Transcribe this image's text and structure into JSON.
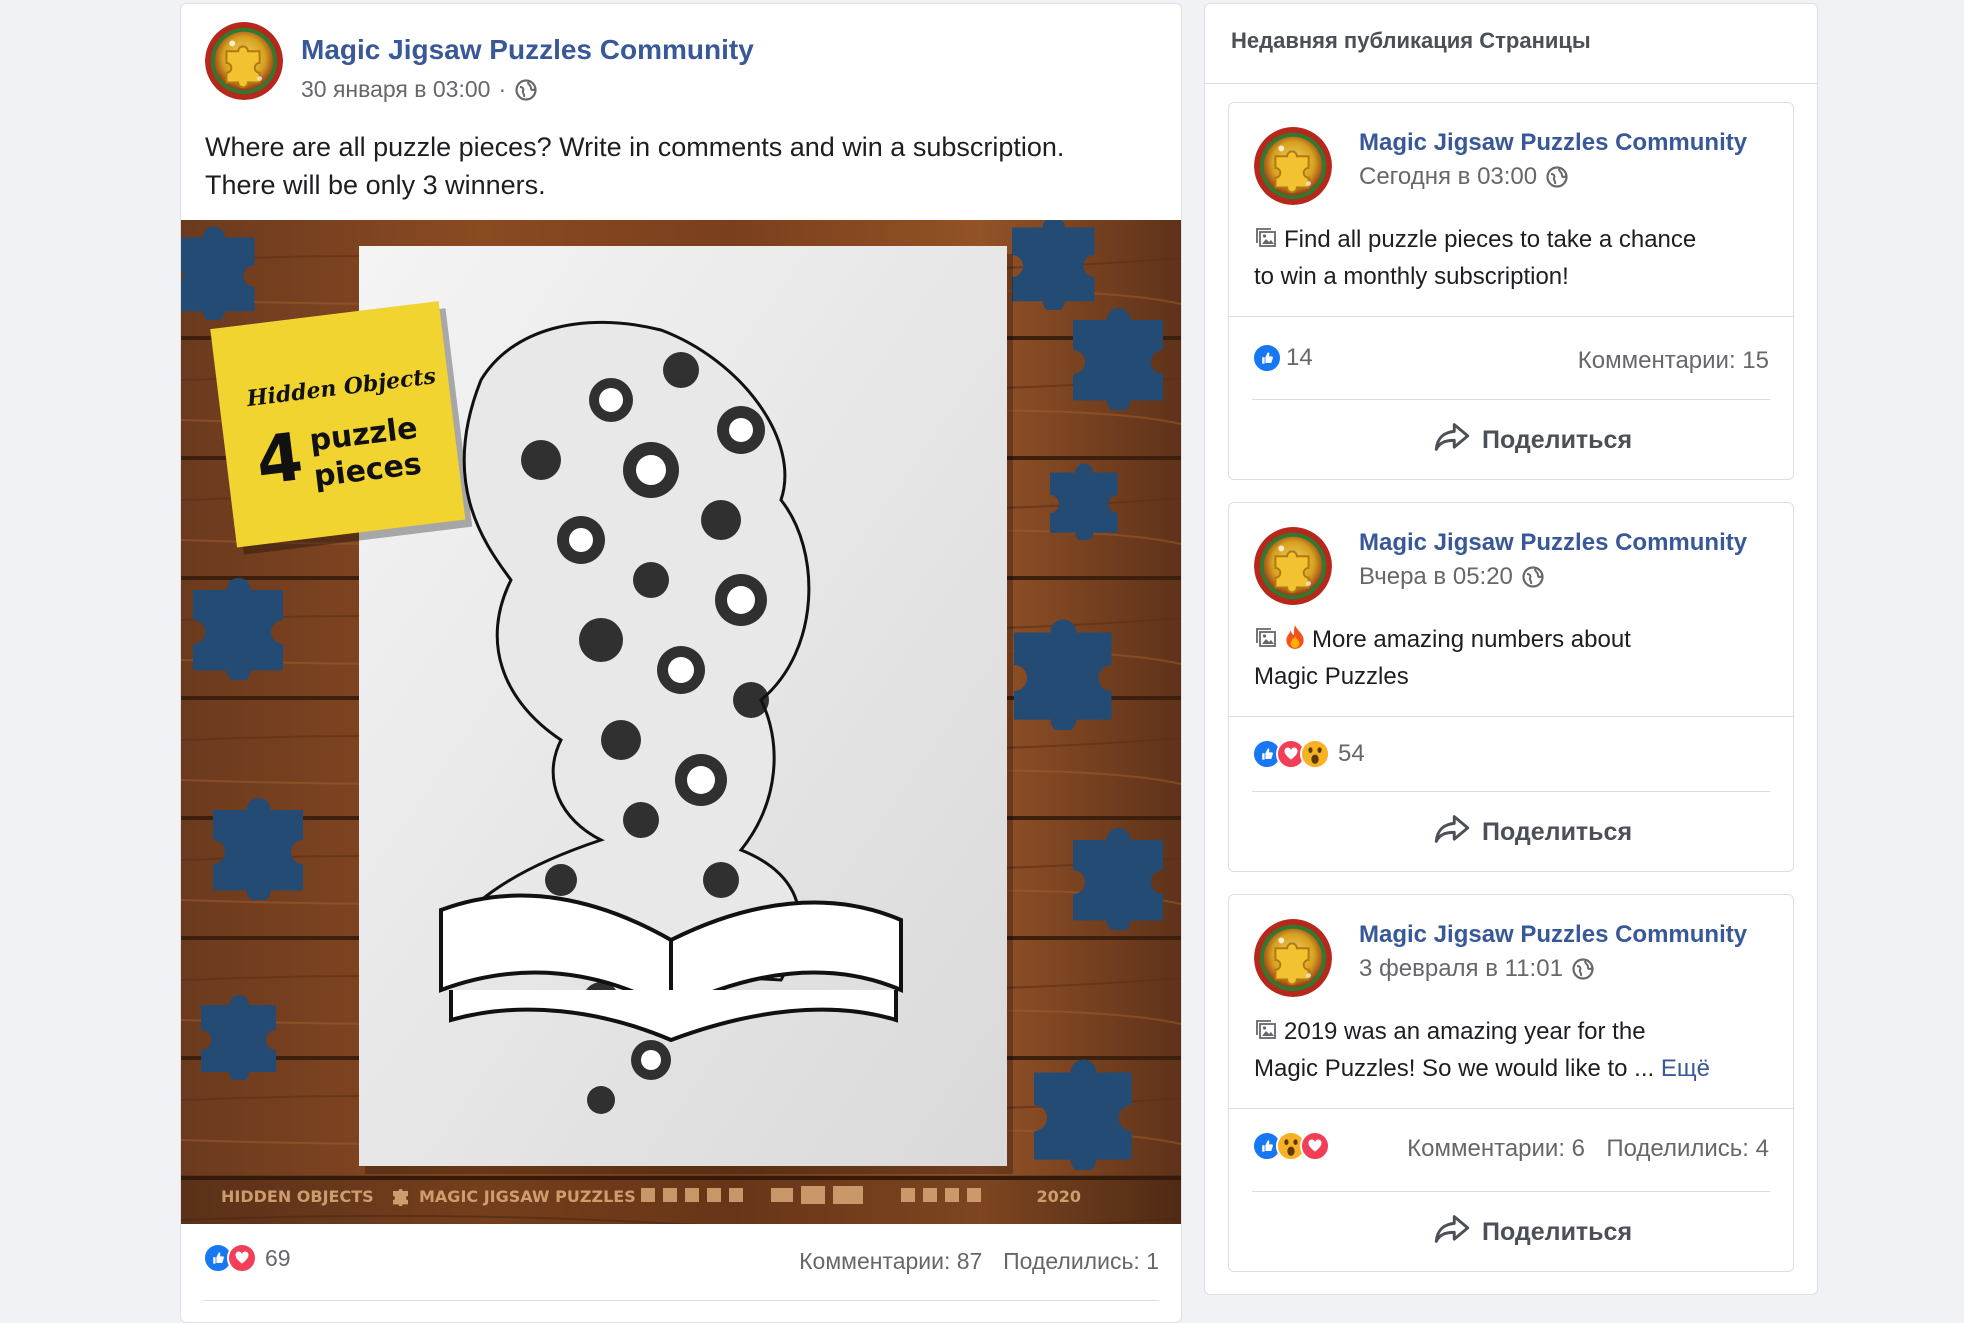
{
  "main_post": {
    "page_name": "Magic Jigsaw Puzzles Community",
    "timestamp": "30 января в 03:00",
    "separator": "·",
    "text_line1": "Where are all puzzle pieces? Write in comments and win a subscription.",
    "text_line2": "There will be only 3 winners.",
    "image": {
      "sticky_title": "Hidden Objects",
      "sticky_number": "4",
      "sticky_line1": "puzzle",
      "sticky_line2": "pieces",
      "footer_left": "HIDDEN OBJECTS",
      "footer_brand": "MAGIC JIGSAW PUZZLES",
      "footer_year": "2020"
    },
    "reaction_count": "69",
    "comments": "Комментарии: 87",
    "shares": "Поделились: 1"
  },
  "sidebar": {
    "title": "Недавняя публикация Страницы",
    "posts": [
      {
        "page_name": "Magic Jigsaw Puzzles Community",
        "timestamp": "Сегодня в 03:00",
        "text_line1": "Find all puzzle pieces to take a chance",
        "text_line2": "to win a monthly subscription!",
        "reaction_count": "14",
        "comments": "Комментарии: 15",
        "share_label": "Поделиться"
      },
      {
        "page_name": "Magic Jigsaw Puzzles Community",
        "timestamp": "Вчера в 05:20",
        "text_line1": "More amazing numbers about",
        "text_line2": "Magic Puzzles",
        "reaction_count": "54",
        "share_label": "Поделиться"
      },
      {
        "page_name": "Magic Jigsaw Puzzles Community",
        "timestamp": "3 февраля в 11:01",
        "text_line1": "2019 was an amazing year for the",
        "text_line2": "Magic Puzzles! So we would like to ...",
        "more_link": "Ещё",
        "comments": "Комментарии: 6",
        "shares": "Поделились: 4",
        "share_label": "Поделиться"
      }
    ]
  },
  "colors": {
    "link": "#385898",
    "like": "#1877f2",
    "love": "#f33e58",
    "wow": "#f7b125",
    "background": "#f0f2f5"
  }
}
